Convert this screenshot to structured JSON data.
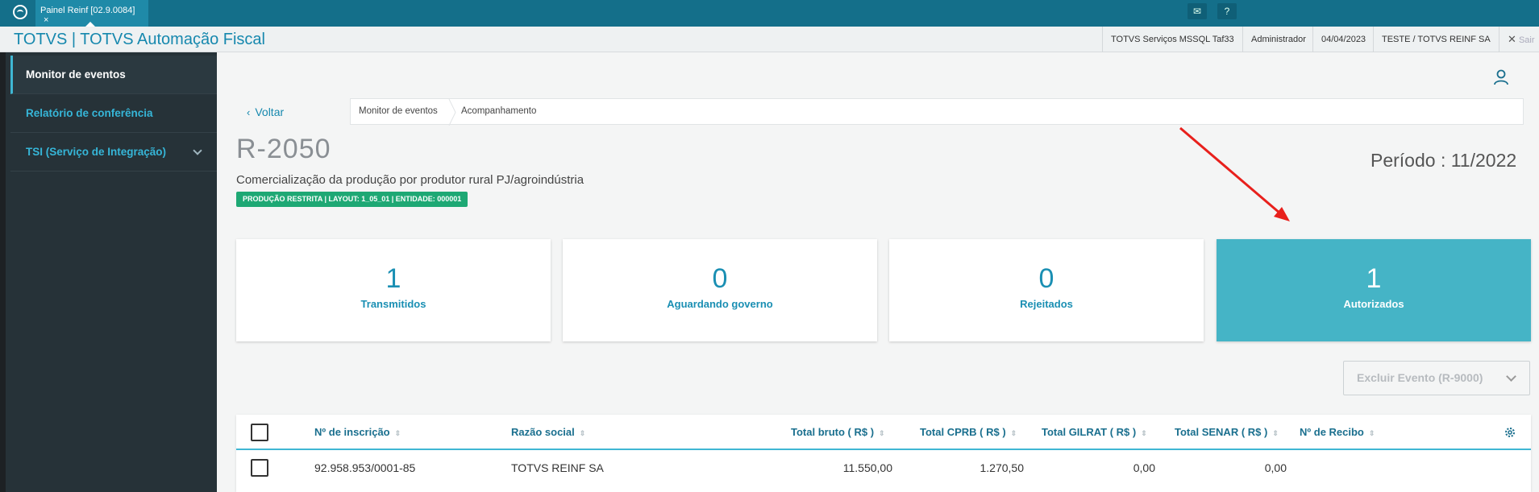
{
  "topbar": {
    "tab_label": "Painel Reinf [02.9.0084]",
    "tab_close": "×",
    "icons": [
      "mail-icon",
      "help-icon"
    ]
  },
  "header": {
    "title": "TOTVS | TOTVS Automação Fiscal",
    "environment": "TOTVS Serviços MSSQL Taf33",
    "user": "Administrador",
    "date": "04/04/2023",
    "company": "TESTE / TOTVS REINF SA",
    "logout": "Sair"
  },
  "sidebar": {
    "items": [
      {
        "label": "Monitor de eventos"
      },
      {
        "label": "Relatório de conferência"
      },
      {
        "label": "TSI (Serviço de Integração)"
      }
    ]
  },
  "nav": {
    "back": "Voltar",
    "breadcrumb": [
      "Monitor de eventos",
      "Acompanhamento"
    ]
  },
  "event": {
    "code": "R-2050",
    "description": "Comercialização da produção por produtor rural PJ/agroindústria",
    "badge": "PRODUÇÃO RESTRITA | LAYOUT: 1_05_01 | ENTIDADE: 000001",
    "periodo": "Período : 11/2022",
    "badge_color": "#1ea874"
  },
  "cards": [
    {
      "value": "1",
      "label": "Transmitidos"
    },
    {
      "value": "0",
      "label": "Aguardando governo"
    },
    {
      "value": "0",
      "label": "Rejeitados"
    },
    {
      "value": "1",
      "label": "Autorizados",
      "active": true
    }
  ],
  "actions": {
    "excluir": "Excluir Evento (R-9000)"
  },
  "table": {
    "headers": [
      "Nº de inscrição",
      "Razão social",
      "Total bruto ( R$ )",
      "Total CPRB ( R$ )",
      "Total GILRAT ( R$ )",
      "Total SENAR ( R$ )",
      "Nº de Recibo"
    ],
    "sort_glyph": "⇕",
    "rows": [
      {
        "inscricao": "92.958.953/0001-85",
        "razao": "TOTVS REINF SA",
        "bruto": "11.550,00",
        "cprb": "1.270,50",
        "gilrat": "0,00",
        "senar": "0,00",
        "recibo": ""
      }
    ]
  },
  "colors": {
    "accent": "#1688ae",
    "topbar": "#146f8a",
    "sidebar": "#263238",
    "active_card": "#45b4c6",
    "annotation_arrow": "#e8201c"
  }
}
